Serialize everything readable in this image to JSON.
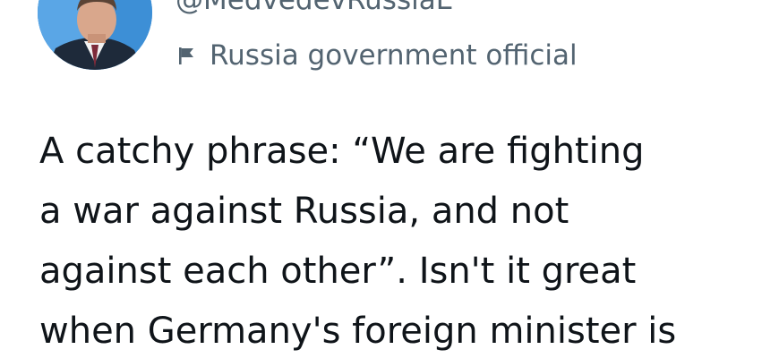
{
  "author": {
    "handle": "@MedvedevRussiaE",
    "avatar_icon": "profile-photo",
    "label_icon": "flag-icon",
    "label": "Russia government official"
  },
  "tweet": {
    "lines": [
      "A catchy phrase: “We are fighting",
      "a war against Russia, and not",
      "against each other”. Isn't it great",
      "when Germany's foreign minister is"
    ]
  },
  "colors": {
    "text_primary": "#0f1419",
    "text_secondary": "#536471",
    "avatar_bg": "#3d8fd6"
  }
}
